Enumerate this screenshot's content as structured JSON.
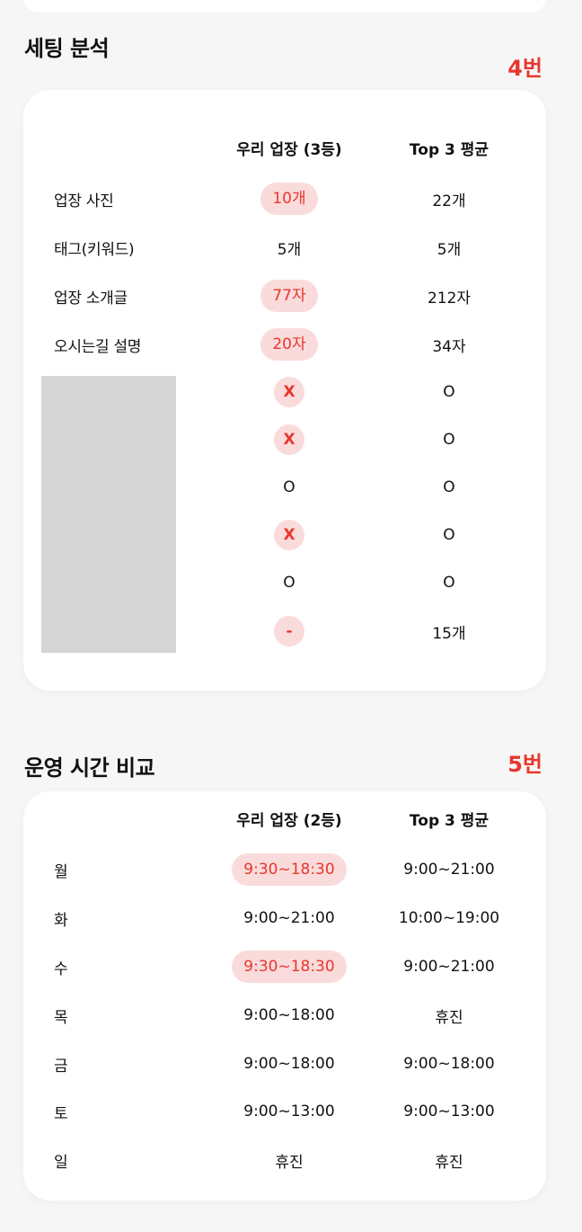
{
  "setting_section": {
    "title": "세팅 분석",
    "number": "4번",
    "headers": {
      "ours": "우리 업장 (3등)",
      "top3": "Top 3 평균"
    },
    "rows": [
      {
        "label": "업장 사진",
        "ours": "10개",
        "top3": "22개",
        "highlight": true
      },
      {
        "label": "태그(키워드)",
        "ours": "5개",
        "top3": "5개",
        "highlight": false
      },
      {
        "label": "업장 소개글",
        "ours": "77자",
        "top3": "212자",
        "highlight": true
      },
      {
        "label": "오시는길 설명",
        "ours": "20자",
        "top3": "34자",
        "highlight": true
      },
      {
        "label": "",
        "ours": "X",
        "top3": "O",
        "highlight": true
      },
      {
        "label": "",
        "ours": "X",
        "top3": "O",
        "highlight": true
      },
      {
        "label": "",
        "ours": "O",
        "top3": "O",
        "highlight": false
      },
      {
        "label": "",
        "ours": "X",
        "top3": "O",
        "highlight": true
      },
      {
        "label": "",
        "ours": "O",
        "top3": "O",
        "highlight": false
      },
      {
        "label": "",
        "ours": "-",
        "top3": "15개",
        "highlight": true
      }
    ]
  },
  "hours_section": {
    "title": "운영 시간 비교",
    "number": "5번",
    "headers": {
      "ours": "우리 업장 (2등)",
      "top3": "Top 3 평균"
    },
    "rows": [
      {
        "label": "월",
        "ours": "9:30~18:30",
        "top3": "9:00~21:00",
        "highlight": true
      },
      {
        "label": "화",
        "ours": "9:00~21:00",
        "top3": "10:00~19:00",
        "highlight": false
      },
      {
        "label": "수",
        "ours": "9:30~18:30",
        "top3": "9:00~21:00",
        "highlight": true
      },
      {
        "label": "목",
        "ours": "9:00~18:00",
        "top3": "휴진",
        "highlight": false
      },
      {
        "label": "금",
        "ours": "9:00~18:00",
        "top3": "9:00~18:00",
        "highlight": false
      },
      {
        "label": "토",
        "ours": "9:00~13:00",
        "top3": "9:00~13:00",
        "highlight": false
      },
      {
        "label": "일",
        "ours": "휴진",
        "top3": "휴진",
        "highlight": false
      }
    ]
  },
  "colors": {
    "accent_red": "#e8362d",
    "highlight_bg": "#fadbdb",
    "card_bg": "#ffffff",
    "page_bg": "#f6f6f6",
    "redaction": "#d6d6d6"
  }
}
